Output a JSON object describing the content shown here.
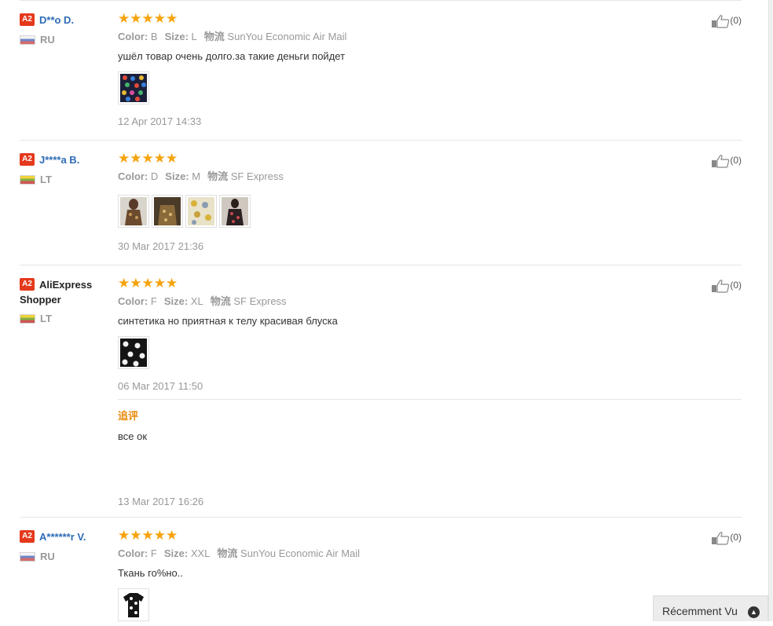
{
  "reviews": [
    {
      "badge": "A2",
      "user": "D**o D.",
      "country": "RU",
      "stars": "★★★★★",
      "color_label": "Color:",
      "color_value": "B",
      "size_label": "Size:",
      "size_value": "L",
      "shipping_label": "物流",
      "shipping_value": "SunYou Economic Air Mail",
      "text": "ушёл товар очень долго.за такие деньги пойдет",
      "date": "12 Apr 2017 14:33",
      "likes": "(0)"
    },
    {
      "badge": "A2",
      "user": "J****a B.",
      "country": "LT",
      "stars": "★★★★★",
      "color_label": "Color:",
      "color_value": "D",
      "size_label": "Size:",
      "size_value": "M",
      "shipping_label": "物流",
      "shipping_value": "SF Express",
      "text": "",
      "date": "30 Mar 2017 21:36",
      "likes": "(0)"
    },
    {
      "badge": "A2",
      "user_line1": "AliExpress",
      "user_line2": "Shopper",
      "country": "LT",
      "stars": "★★★★★",
      "color_label": "Color:",
      "color_value": "F",
      "size_label": "Size:",
      "size_value": "XL",
      "shipping_label": "物流",
      "shipping_value": "SF Express",
      "text": "синтетика но приятная к телу красивая блуска",
      "date": "06 Mar 2017 11:50",
      "likes": "(0)",
      "additional_label": "追评",
      "additional_text": "все ок",
      "additional_date": "13 Mar 2017 16:26"
    },
    {
      "badge": "A2",
      "user": "A******r V.",
      "country": "RU",
      "stars": "★★★★★",
      "color_label": "Color:",
      "color_value": "F",
      "size_label": "Size:",
      "size_value": "XXL",
      "shipping_label": "物流",
      "shipping_value": "SunYou Economic Air Mail",
      "text": "Ткань го%но..",
      "likes": "(0)"
    }
  ],
  "recently_viewed": "Récemment Vu",
  "icons": {
    "like": "thumbs-up-icon",
    "scroll_top": "chevron-up-icon"
  },
  "colors": {
    "username": "#2d6bb6",
    "stars": "#f6a30b",
    "badge": "#e5391d",
    "additional_label": "#e88c0e"
  }
}
